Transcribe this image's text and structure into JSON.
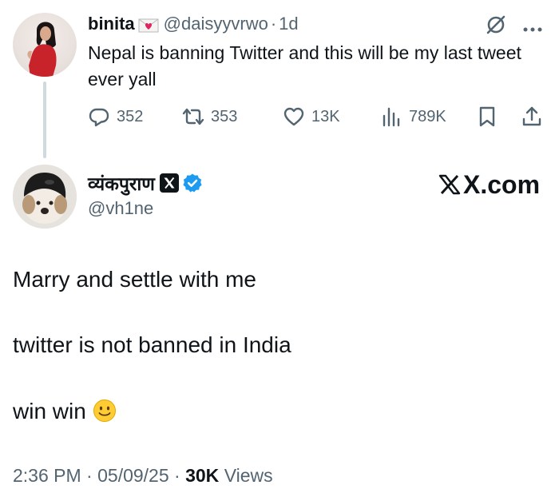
{
  "parent_tweet": {
    "display_name": "binita",
    "handle": "@daisyyvrwo",
    "separator": "·",
    "time_ago": "1d",
    "text": "Nepal is banning Twitter and this will be my last tweet ever yall",
    "stats": {
      "replies": "352",
      "reposts": "353",
      "likes": "13K",
      "views": "789K"
    }
  },
  "main_tweet": {
    "display_name": "व्यंकपुराण",
    "handle": "@vh1ne",
    "watermark": "X.com",
    "lines": [
      "Marry and settle with me",
      "twitter is not banned in India",
      "win win"
    ],
    "meta": {
      "time": "2:36 PM",
      "sep1": "·",
      "date": "05/09/25",
      "sep2": "·",
      "views_count": "30K",
      "views_label": "Views"
    }
  },
  "colors": {
    "text": "#0f1419",
    "secondary": "#536471",
    "verified_blue": "#1d9bf0",
    "thread_line": "#cfd9de"
  },
  "icons": [
    "envelope-heart-icon",
    "grok-slash-icon",
    "more-icon",
    "reply-icon",
    "repost-icon",
    "like-icon",
    "views-icon",
    "bookmark-icon",
    "share-icon",
    "x-logo-icon",
    "verified-icon",
    "smiley-icon"
  ]
}
